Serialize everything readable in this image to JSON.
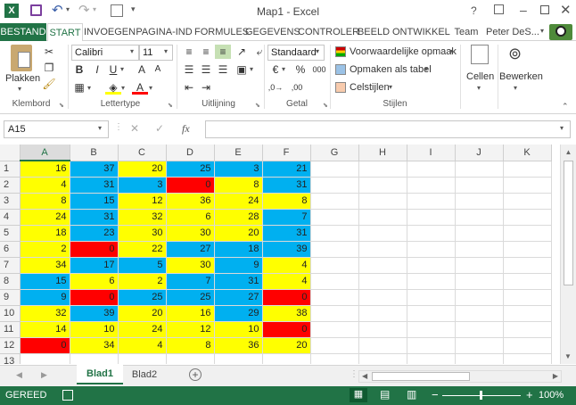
{
  "window": {
    "title": "Map1 - Excel"
  },
  "tabs": {
    "file": "BESTAND",
    "start": "START",
    "invoegen": "INVOEGEN",
    "pagina": "PAGINA-IND",
    "formules": "FORMULES",
    "gegevens": "GEGEVENS",
    "controler": "CONTROLER",
    "beeld": "BEELD",
    "ontwikkel": "ONTWIKKEL",
    "team": "Team",
    "user": "Peter DeS..."
  },
  "ribbon": {
    "plakken": "Plakken",
    "klembord": "Klembord",
    "font_name": "Calibri",
    "font_size": "11",
    "lettertype": "Lettertype",
    "uitlijning": "Uitlijning",
    "number_format": "Standaard",
    "getal": "Getal",
    "voorwaardelijke": "Voorwaardelijke opmaak",
    "opmaken_tabel": "Opmaken als tabel",
    "celstijlen": "Celstijlen",
    "stijlen": "Stijlen",
    "cellen": "Cellen",
    "bewerken": "Bewerken",
    "bold": "B",
    "italic": "I",
    "underline": "U",
    "percent": "%",
    "thousands": "000"
  },
  "formula_bar": {
    "name_box": "A15",
    "fx": "fx",
    "value": ""
  },
  "columns": [
    "A",
    "B",
    "C",
    "D",
    "E",
    "F",
    "G",
    "H",
    "I",
    "J",
    "K"
  ],
  "rows": [
    {
      "n": "1",
      "cells": [
        {
          "v": "16",
          "c": "y"
        },
        {
          "v": "37",
          "c": "b"
        },
        {
          "v": "20",
          "c": "y"
        },
        {
          "v": "25",
          "c": "b"
        },
        {
          "v": "3",
          "c": "b"
        },
        {
          "v": "21",
          "c": "b"
        }
      ]
    },
    {
      "n": "2",
      "cells": [
        {
          "v": "4",
          "c": "y"
        },
        {
          "v": "31",
          "c": "b"
        },
        {
          "v": "3",
          "c": "b"
        },
        {
          "v": "0",
          "c": "r"
        },
        {
          "v": "8",
          "c": "y"
        },
        {
          "v": "31",
          "c": "b"
        }
      ]
    },
    {
      "n": "3",
      "cells": [
        {
          "v": "8",
          "c": "y"
        },
        {
          "v": "15",
          "c": "b"
        },
        {
          "v": "12",
          "c": "y"
        },
        {
          "v": "36",
          "c": "y"
        },
        {
          "v": "24",
          "c": "y"
        },
        {
          "v": "8",
          "c": "y"
        }
      ]
    },
    {
      "n": "4",
      "cells": [
        {
          "v": "24",
          "c": "y"
        },
        {
          "v": "31",
          "c": "b"
        },
        {
          "v": "32",
          "c": "y"
        },
        {
          "v": "6",
          "c": "y"
        },
        {
          "v": "28",
          "c": "y"
        },
        {
          "v": "7",
          "c": "b"
        }
      ]
    },
    {
      "n": "5",
      "cells": [
        {
          "v": "18",
          "c": "y"
        },
        {
          "v": "23",
          "c": "b"
        },
        {
          "v": "30",
          "c": "y"
        },
        {
          "v": "30",
          "c": "y"
        },
        {
          "v": "20",
          "c": "y"
        },
        {
          "v": "31",
          "c": "b"
        }
      ]
    },
    {
      "n": "6",
      "cells": [
        {
          "v": "2",
          "c": "y"
        },
        {
          "v": "0",
          "c": "r"
        },
        {
          "v": "22",
          "c": "y"
        },
        {
          "v": "27",
          "c": "b"
        },
        {
          "v": "18",
          "c": "b"
        },
        {
          "v": "39",
          "c": "b"
        }
      ]
    },
    {
      "n": "7",
      "cells": [
        {
          "v": "34",
          "c": "y"
        },
        {
          "v": "17",
          "c": "b"
        },
        {
          "v": "5",
          "c": "b"
        },
        {
          "v": "30",
          "c": "y"
        },
        {
          "v": "9",
          "c": "b"
        },
        {
          "v": "4",
          "c": "y"
        }
      ]
    },
    {
      "n": "8",
      "cells": [
        {
          "v": "15",
          "c": "b"
        },
        {
          "v": "6",
          "c": "y"
        },
        {
          "v": "2",
          "c": "y"
        },
        {
          "v": "7",
          "c": "b"
        },
        {
          "v": "31",
          "c": "b"
        },
        {
          "v": "4",
          "c": "y"
        }
      ]
    },
    {
      "n": "9",
      "cells": [
        {
          "v": "9",
          "c": "b"
        },
        {
          "v": "0",
          "c": "r"
        },
        {
          "v": "25",
          "c": "b"
        },
        {
          "v": "25",
          "c": "b"
        },
        {
          "v": "27",
          "c": "b"
        },
        {
          "v": "0",
          "c": "r"
        }
      ]
    },
    {
      "n": "10",
      "cells": [
        {
          "v": "32",
          "c": "y"
        },
        {
          "v": "39",
          "c": "b"
        },
        {
          "v": "20",
          "c": "y"
        },
        {
          "v": "16",
          "c": "y"
        },
        {
          "v": "29",
          "c": "b"
        },
        {
          "v": "38",
          "c": "y"
        }
      ]
    },
    {
      "n": "11",
      "cells": [
        {
          "v": "14",
          "c": "y"
        },
        {
          "v": "10",
          "c": "y"
        },
        {
          "v": "24",
          "c": "y"
        },
        {
          "v": "12",
          "c": "y"
        },
        {
          "v": "10",
          "c": "y"
        },
        {
          "v": "0",
          "c": "r"
        }
      ]
    },
    {
      "n": "12",
      "cells": [
        {
          "v": "0",
          "c": "r"
        },
        {
          "v": "34",
          "c": "y"
        },
        {
          "v": "4",
          "c": "y"
        },
        {
          "v": "8",
          "c": "y"
        },
        {
          "v": "36",
          "c": "y"
        },
        {
          "v": "20",
          "c": "y"
        }
      ]
    },
    {
      "n": "13",
      "cells": []
    }
  ],
  "sheets": {
    "active": "Blad1",
    "other": "Blad2"
  },
  "status": {
    "ready": "GEREED",
    "zoom": "100%"
  },
  "colors": {
    "accent": "#217346",
    "yellow": "#ffff00",
    "blue": "#00b0f0",
    "red": "#ff0000"
  }
}
